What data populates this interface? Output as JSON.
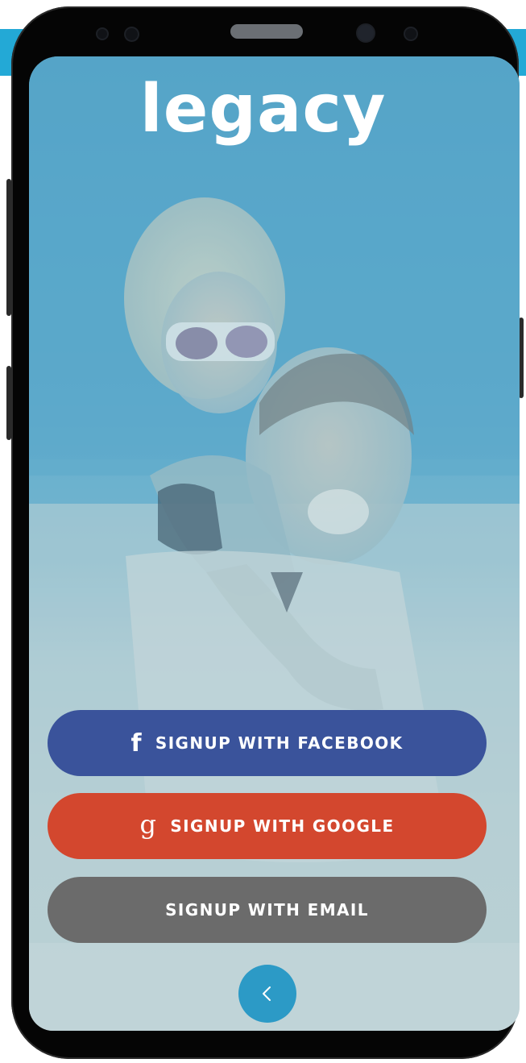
{
  "app": {
    "name": "legacy",
    "accent_color": "#23a9d6"
  },
  "buttons": {
    "facebook": {
      "label": "SIGNUP WITH FACEBOOK",
      "icon": "facebook-f-icon",
      "icon_glyph": "f",
      "color": "#3a539b"
    },
    "google": {
      "label": "SIGNUP WITH GOOGLE",
      "icon": "google-g-icon",
      "icon_glyph": "g",
      "color": "#d3472e"
    },
    "email": {
      "label": "SIGNUP WITH EMAIL",
      "color": "#6b6b6b"
    }
  },
  "back_button": {
    "icon": "chevron-left-icon",
    "color": "#2c9ac6"
  }
}
